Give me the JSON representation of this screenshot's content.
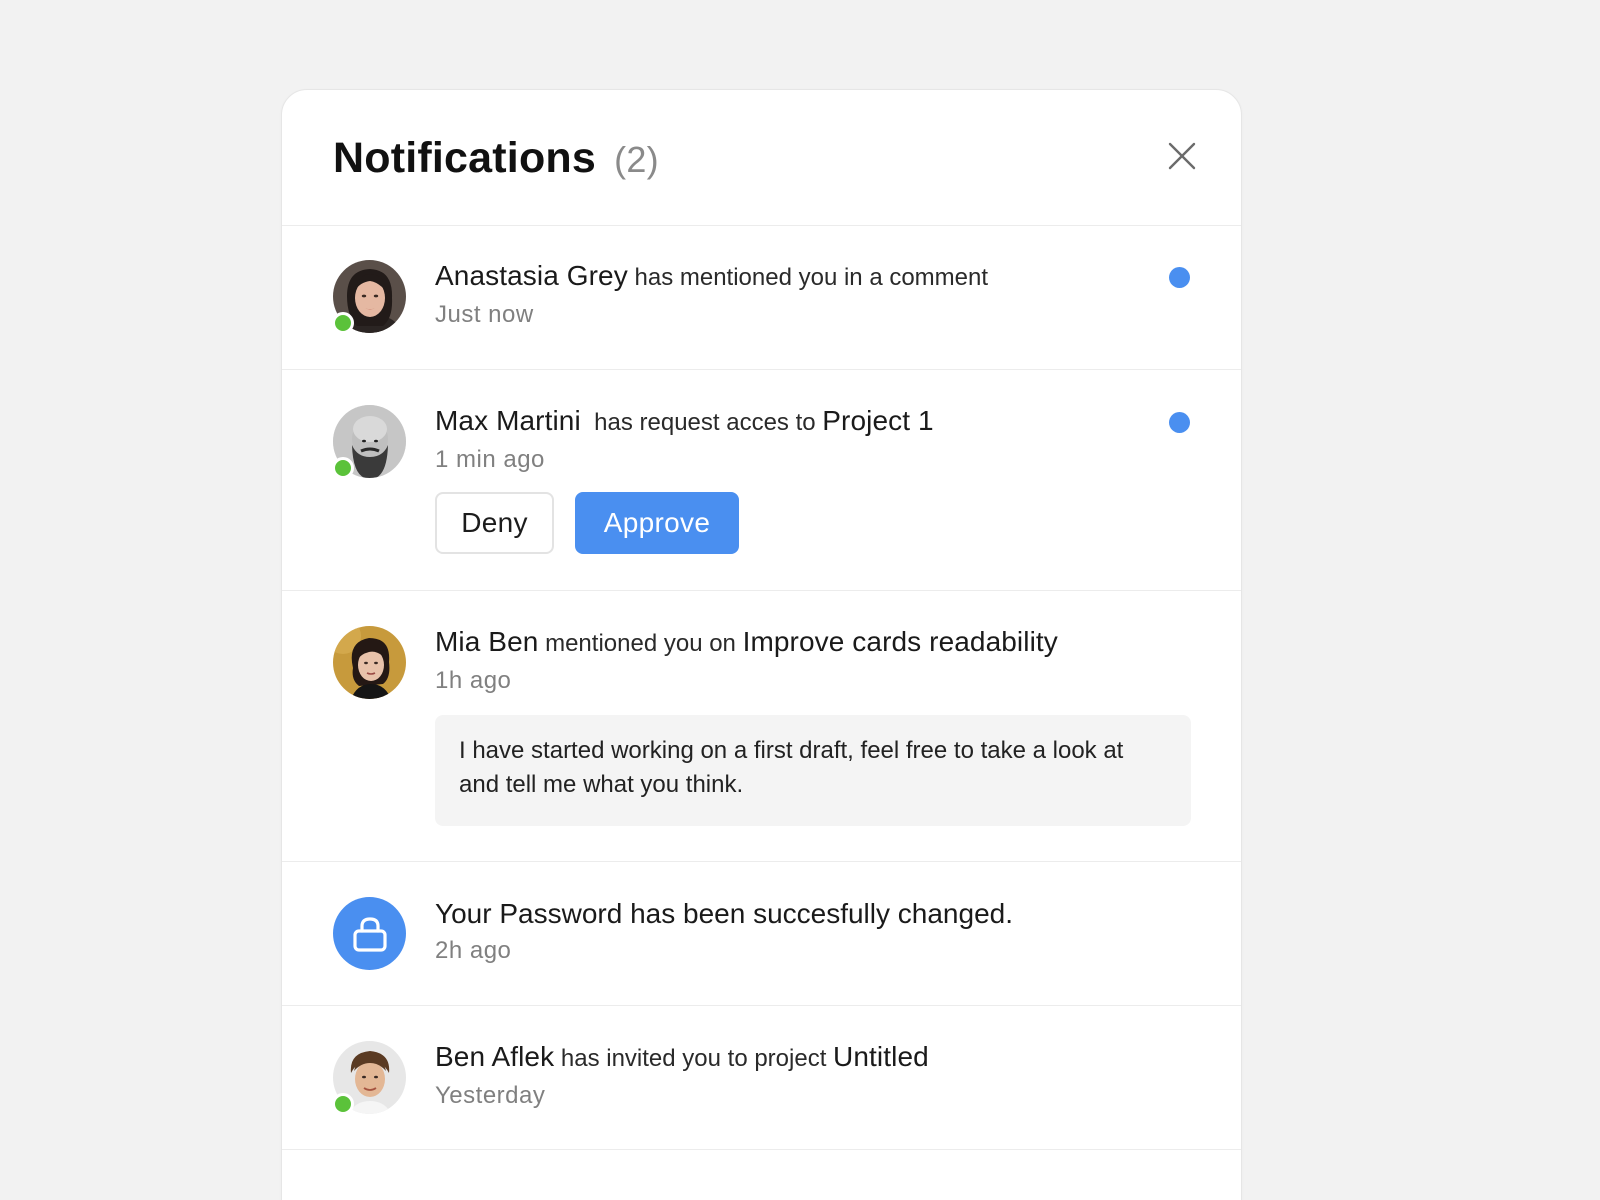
{
  "header": {
    "title": "Notifications",
    "count": "(2)"
  },
  "notifications": [
    {
      "name": "Anastasia Grey",
      "action": "has mentioned you in a comment",
      "time": "Just now"
    },
    {
      "name": "Max Martini",
      "action": "has request acces to",
      "target": "Project 1",
      "time": "1 min ago",
      "deny_label": "Deny",
      "approve_label": "Approve"
    },
    {
      "name": "Mia Ben",
      "action": "mentioned you on",
      "target": "Improve cards readability",
      "time": "1h ago",
      "quote": "I have started working on a first draft, feel free to take a look at and tell me what you think."
    },
    {
      "message": "Your Password has been succesfully changed.",
      "time": "2h ago"
    },
    {
      "name": "Ben Aflek",
      "action": "has invited you to project",
      "target": "Untitled",
      "time": "Yesterday"
    }
  ],
  "colors": {
    "accent": "#4a8ff0",
    "online": "#5bc23a",
    "background": "#f2f2f2"
  }
}
